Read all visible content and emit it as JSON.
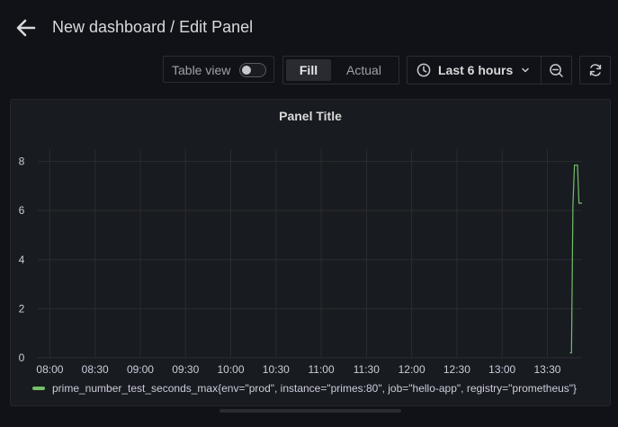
{
  "header": {
    "title": "New dashboard / Edit Panel"
  },
  "toolbar": {
    "table_view_label": "Table view",
    "table_view_on": false,
    "fill_label": "Fill",
    "actual_label": "Actual",
    "time_range_label": "Last 6 hours"
  },
  "panel": {
    "title": "Panel Title"
  },
  "icons": {
    "back": "arrow-left-icon",
    "clock": "clock-icon",
    "chevron": "chevron-down-icon",
    "zoom_out": "zoom-out-icon",
    "refresh": "refresh-icon"
  },
  "colors": {
    "series": "#73bf69",
    "background": "#111217",
    "panel": "#181b1f"
  },
  "chart_data": {
    "type": "line",
    "title": "Panel Title",
    "x_tick_labels": [
      "08:00",
      "08:30",
      "09:00",
      "09:30",
      "10:00",
      "10:30",
      "11:00",
      "11:30",
      "12:00",
      "12:30",
      "13:00",
      "13:30"
    ],
    "y_tick_labels": [
      "0",
      "2",
      "4",
      "6",
      "8"
    ],
    "ylim": [
      0,
      8.5
    ],
    "xlim": [
      "07:52",
      "13:53"
    ],
    "grid": true,
    "legend_position": "bottom-left",
    "series": [
      {
        "name": "prime_number_test_seconds_max{env=\"prod\", instance=\"primes:80\", job=\"hello-app\", registry=\"prometheus\"}",
        "color": "#73bf69",
        "points": [
          {
            "x": "13:45",
            "y": 0.2
          },
          {
            "x": "13:46",
            "y": 0.2
          },
          {
            "x": "13:47",
            "y": 6.2
          },
          {
            "x": "13:48",
            "y": 7.85
          },
          {
            "x": "13:50",
            "y": 7.85
          },
          {
            "x": "13:51",
            "y": 6.3
          },
          {
            "x": "13:53",
            "y": 6.3
          }
        ]
      }
    ]
  }
}
